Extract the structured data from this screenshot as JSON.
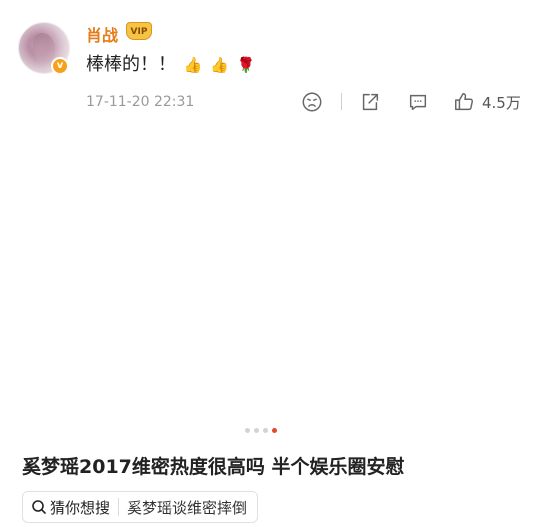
{
  "post": {
    "username": "肖战",
    "vip_badge": "VIP",
    "verified_mark": "v",
    "text": "棒棒的！！",
    "emojis": [
      "👍",
      "👍",
      "🌹"
    ],
    "timestamp": "17-11-20 22:31",
    "like_count": "4.5万"
  },
  "icons": {
    "avatar": "avatar-image",
    "action_1": "sad-face-icon",
    "action_2": "share-icon",
    "action_3": "comment-icon",
    "action_4": "thumbs-up-icon",
    "search": "search-icon"
  },
  "carousel": {
    "total": 4,
    "active_index": 3
  },
  "headline": "奚梦瑶2017维密热度很高吗 半个娱乐圈安慰",
  "search": {
    "label": "猜你想搜",
    "query": "奚梦瑶谈维密摔倒"
  },
  "colors": {
    "username": "#e67c1a",
    "verified": "#f7a11a",
    "active_dot": "#e8452c",
    "muted_text": "#9a9a9a"
  }
}
